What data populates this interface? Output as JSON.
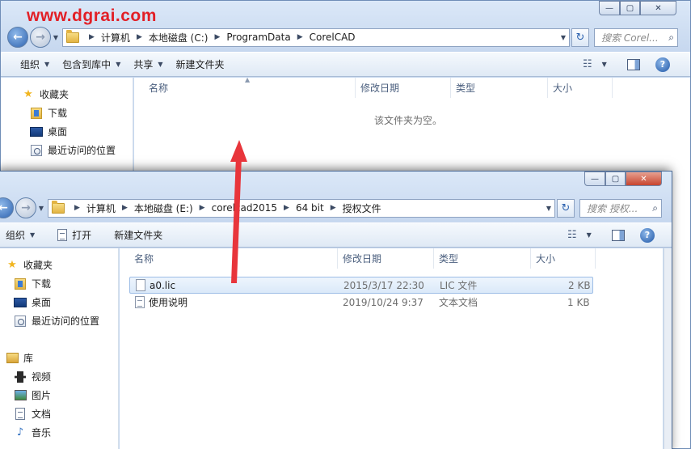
{
  "watermark": "www.dgrai.com",
  "colors": {
    "accent": "#2e63b0",
    "arrow": "#e8353b",
    "selection": "#dbe9f9"
  },
  "back_window": {
    "caption_buttons": {
      "minimize": "—",
      "maximize": "▢",
      "close": "✕"
    },
    "breadcrumb": [
      "计算机",
      "本地磁盘 (C:)",
      "ProgramData",
      "CorelCAD"
    ],
    "search_placeholder": "搜索 Corel...",
    "toolbar": {
      "organize": "组织",
      "include_in_library": "包含到库中",
      "share": "共享",
      "new_folder": "新建文件夹"
    },
    "columns": {
      "name": "名称",
      "date": "修改日期",
      "type": "类型",
      "size": "大小"
    },
    "empty_message": "该文件夹为空。",
    "sidebar": {
      "favorites": "收藏夹",
      "downloads": "下载",
      "desktop": "桌面",
      "recent": "最近访问的位置"
    }
  },
  "front_window": {
    "caption_buttons": {
      "minimize": "—",
      "maximize": "▢",
      "close": "✕"
    },
    "breadcrumb": [
      "计算机",
      "本地磁盘 (E:)",
      "corelcad2015",
      "64 bit",
      "授权文件"
    ],
    "search_placeholder": "搜索 授权...",
    "toolbar": {
      "organize": "组织",
      "open": "打开",
      "new_folder": "新建文件夹"
    },
    "columns": {
      "name": "名称",
      "date": "修改日期",
      "type": "类型",
      "size": "大小"
    },
    "files": [
      {
        "name": "a0.lic",
        "date": "2015/3/17 22:30",
        "type": "LIC 文件",
        "size": "2 KB",
        "icon": "file-icon",
        "selected": true
      },
      {
        "name": "使用说明",
        "date": "2019/10/24 9:37",
        "type": "文本文档",
        "size": "1 KB",
        "icon": "text-file-icon",
        "selected": false
      }
    ],
    "sidebar": {
      "favorites": "收藏夹",
      "downloads": "下载",
      "desktop": "桌面",
      "recent": "最近访问的位置",
      "libraries": "库",
      "videos": "视频",
      "pictures": "图片",
      "documents": "文档",
      "music": "音乐"
    }
  }
}
